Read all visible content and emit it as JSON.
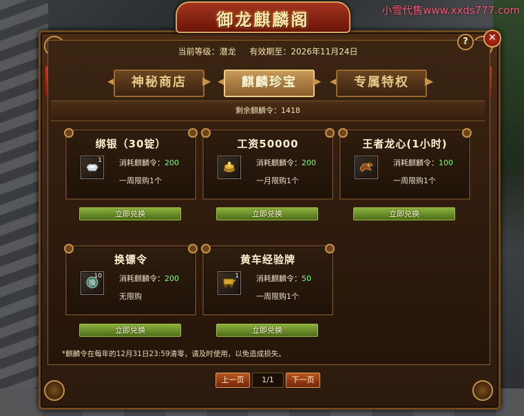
{
  "watermark": "小雪代售www.xxds777.com",
  "title": "御龙麒麟阁",
  "header": {
    "level_label": "当前等级：潜龙",
    "expiry_label": "有效期至：2026年11月24日"
  },
  "tabs": [
    "神秘商店",
    "麒麟珍宝",
    "专属特权"
  ],
  "active_tab": "麒麟珍宝",
  "remaining": "剩余麒麟令：1418",
  "items": [
    {
      "name": "绑银（30锭）",
      "qty": "1",
      "cost_label": "消耗麒麟令：",
      "cost": "200",
      "limit": "一周限购1个",
      "button": "立即兑换",
      "icon": "silver-ingot-icon"
    },
    {
      "name": "工资50000",
      "qty": "",
      "cost_label": "消耗麒麟令：",
      "cost": "200",
      "limit": "一月限购1个",
      "button": "立即兑换",
      "icon": "gold-coin-icon"
    },
    {
      "name": "王者龙心(1小时)",
      "qty": "",
      "cost_label": "消耗麒麟令：",
      "cost": "100",
      "limit": "一周限购1个",
      "button": "立即兑换",
      "icon": "dragon-heart-icon"
    },
    {
      "name": "换镖令",
      "qty": "10",
      "cost_label": "消耗麒麟令：",
      "cost": "200",
      "limit": "无限购",
      "button": "立即兑换",
      "icon": "escort-token-icon"
    },
    {
      "name": "黄车经验牌",
      "qty": "1",
      "cost_label": "消耗麒麟令：",
      "cost": "50",
      "limit": "一周限购1个",
      "button": "立即兑换",
      "icon": "yellow-cart-icon"
    }
  ],
  "notice": "*麒麟令在每年的12月31日23:59清零，请及时使用，以免造成损失。",
  "pagination": {
    "prev": "上一页",
    "page": "1/1",
    "next": "下一页"
  },
  "colors": {
    "accent_green": "#7dff6a",
    "button_green": "#8cb03c",
    "page_button": "#b8541e",
    "close_red": "#c0301c"
  }
}
